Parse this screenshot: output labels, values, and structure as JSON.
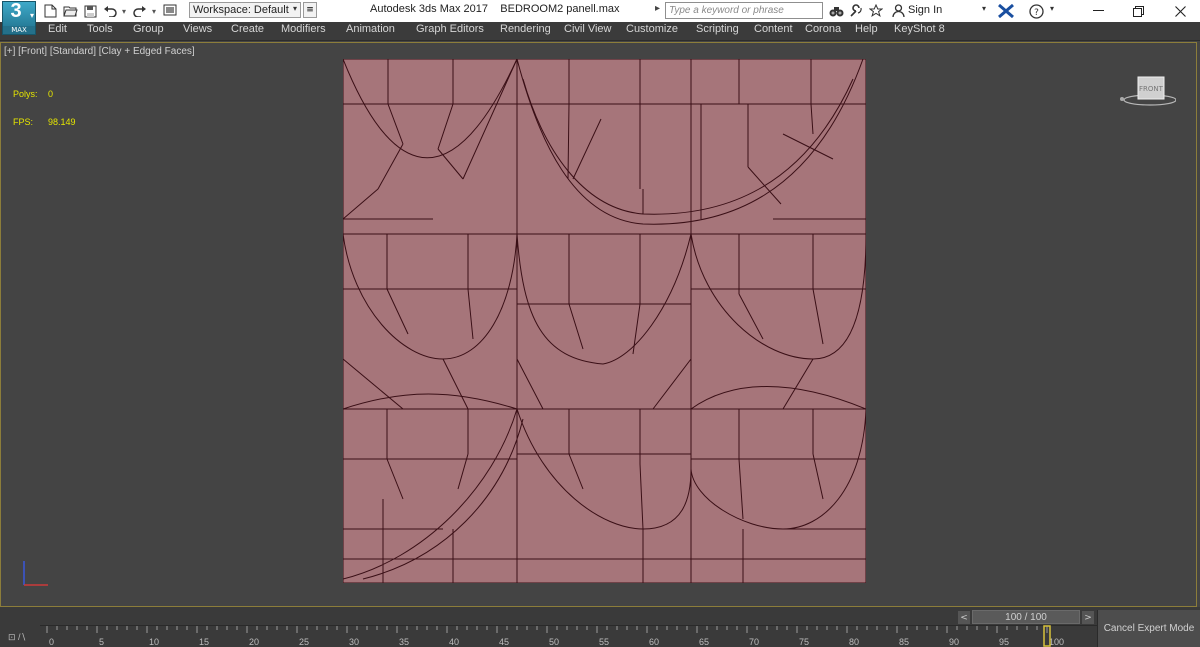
{
  "app": {
    "logo_text": "3",
    "logo_sub": "MAX",
    "title": "Autodesk 3ds Max 2017",
    "file_name": "BEDROOM2 panell.max"
  },
  "toolbar": {
    "workspace_label": "Workspace: Default",
    "search_placeholder": "Type a keyword or phrase",
    "sign_in": "Sign In"
  },
  "menu": [
    "Edit",
    "Tools",
    "Group",
    "Views",
    "Create",
    "Modifiers",
    "Animation",
    "Graph Editors",
    "Rendering",
    "Civil View",
    "Customize",
    "Scripting",
    "Content",
    "Corona",
    "Help",
    "KeyShot 8"
  ],
  "viewport": {
    "label": "[+] [Front] [Standard] [Clay + Edged Faces]",
    "polys_label": "Polys:",
    "polys_value": "0",
    "fps_label": "FPS:",
    "fps_value": "98.149",
    "viewcube_label": "FRONT",
    "mesh_color": "#a6757a",
    "wire_color": "#3a0f16"
  },
  "timeline": {
    "frame_display": "100 / 100",
    "current_frame": 100,
    "total_frames": 100,
    "ticks": [
      "0",
      "5",
      "10",
      "15",
      "20",
      "25",
      "30",
      "35",
      "40",
      "45",
      "50",
      "55",
      "60",
      "65",
      "70",
      "75",
      "80",
      "85",
      "90",
      "95",
      "100"
    ],
    "cancel_expert": "Cancel Expert Mode"
  }
}
